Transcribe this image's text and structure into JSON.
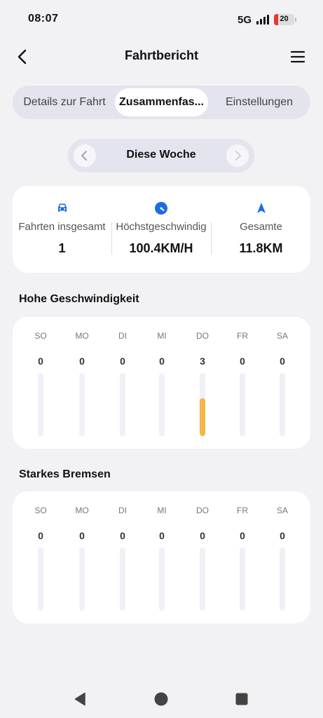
{
  "status_bar": {
    "time": "08:07",
    "network": "5G",
    "battery": "20"
  },
  "header": {
    "title": "Fahrtbericht",
    "back_icon": "back-arrow-icon",
    "menu_icon": "hamburger-menu-icon"
  },
  "tabs": [
    {
      "label": "Details zur Fahrt",
      "active": false
    },
    {
      "label": "Zusammenfas...",
      "active": true
    },
    {
      "label": "Einstellungen",
      "active": false
    }
  ],
  "period": {
    "label": "Diese Woche",
    "prev_icon": "chevron-left-icon",
    "next_icon": "chevron-right-icon"
  },
  "stats": [
    {
      "icon": "car-icon",
      "label": "Fahrten insgesamt",
      "value": "1"
    },
    {
      "icon": "speedometer-icon",
      "label": "Höchstgeschwindig",
      "value": "100.4KM/H"
    },
    {
      "icon": "navigation-arrow-icon",
      "label": "Gesamte",
      "value": "11.8KM"
    }
  ],
  "high_speed": {
    "title": "Hohe Geschwindigkeit",
    "days": [
      {
        "day": "SO",
        "count": "0",
        "level": 0
      },
      {
        "day": "MO",
        "count": "0",
        "level": 0
      },
      {
        "day": "DI",
        "count": "0",
        "level": 0
      },
      {
        "day": "MI",
        "count": "0",
        "level": 0
      },
      {
        "day": "DO",
        "count": "3",
        "level": 0.6
      },
      {
        "day": "FR",
        "count": "0",
        "level": 0
      },
      {
        "day": "SA",
        "count": "0",
        "level": 0
      }
    ]
  },
  "hard_braking": {
    "title": "Starkes Bremsen",
    "days": [
      {
        "day": "SO",
        "count": "0",
        "level": 0
      },
      {
        "day": "MO",
        "count": "0",
        "level": 0
      },
      {
        "day": "DI",
        "count": "0",
        "level": 0
      },
      {
        "day": "MI",
        "count": "0",
        "level": 0
      },
      {
        "day": "DO",
        "count": "0",
        "level": 0
      },
      {
        "day": "FR",
        "count": "0",
        "level": 0
      },
      {
        "day": "SA",
        "count": "0",
        "level": 0
      }
    ]
  },
  "colors": {
    "accent_blue": "#1a6fe0",
    "bar_fill": "#f5b54a",
    "bar_track": "#f0f0f8"
  },
  "nav": {
    "back_icon": "nav-back-triangle-icon",
    "home_icon": "nav-home-circle-icon",
    "recents_icon": "nav-recents-square-icon"
  }
}
